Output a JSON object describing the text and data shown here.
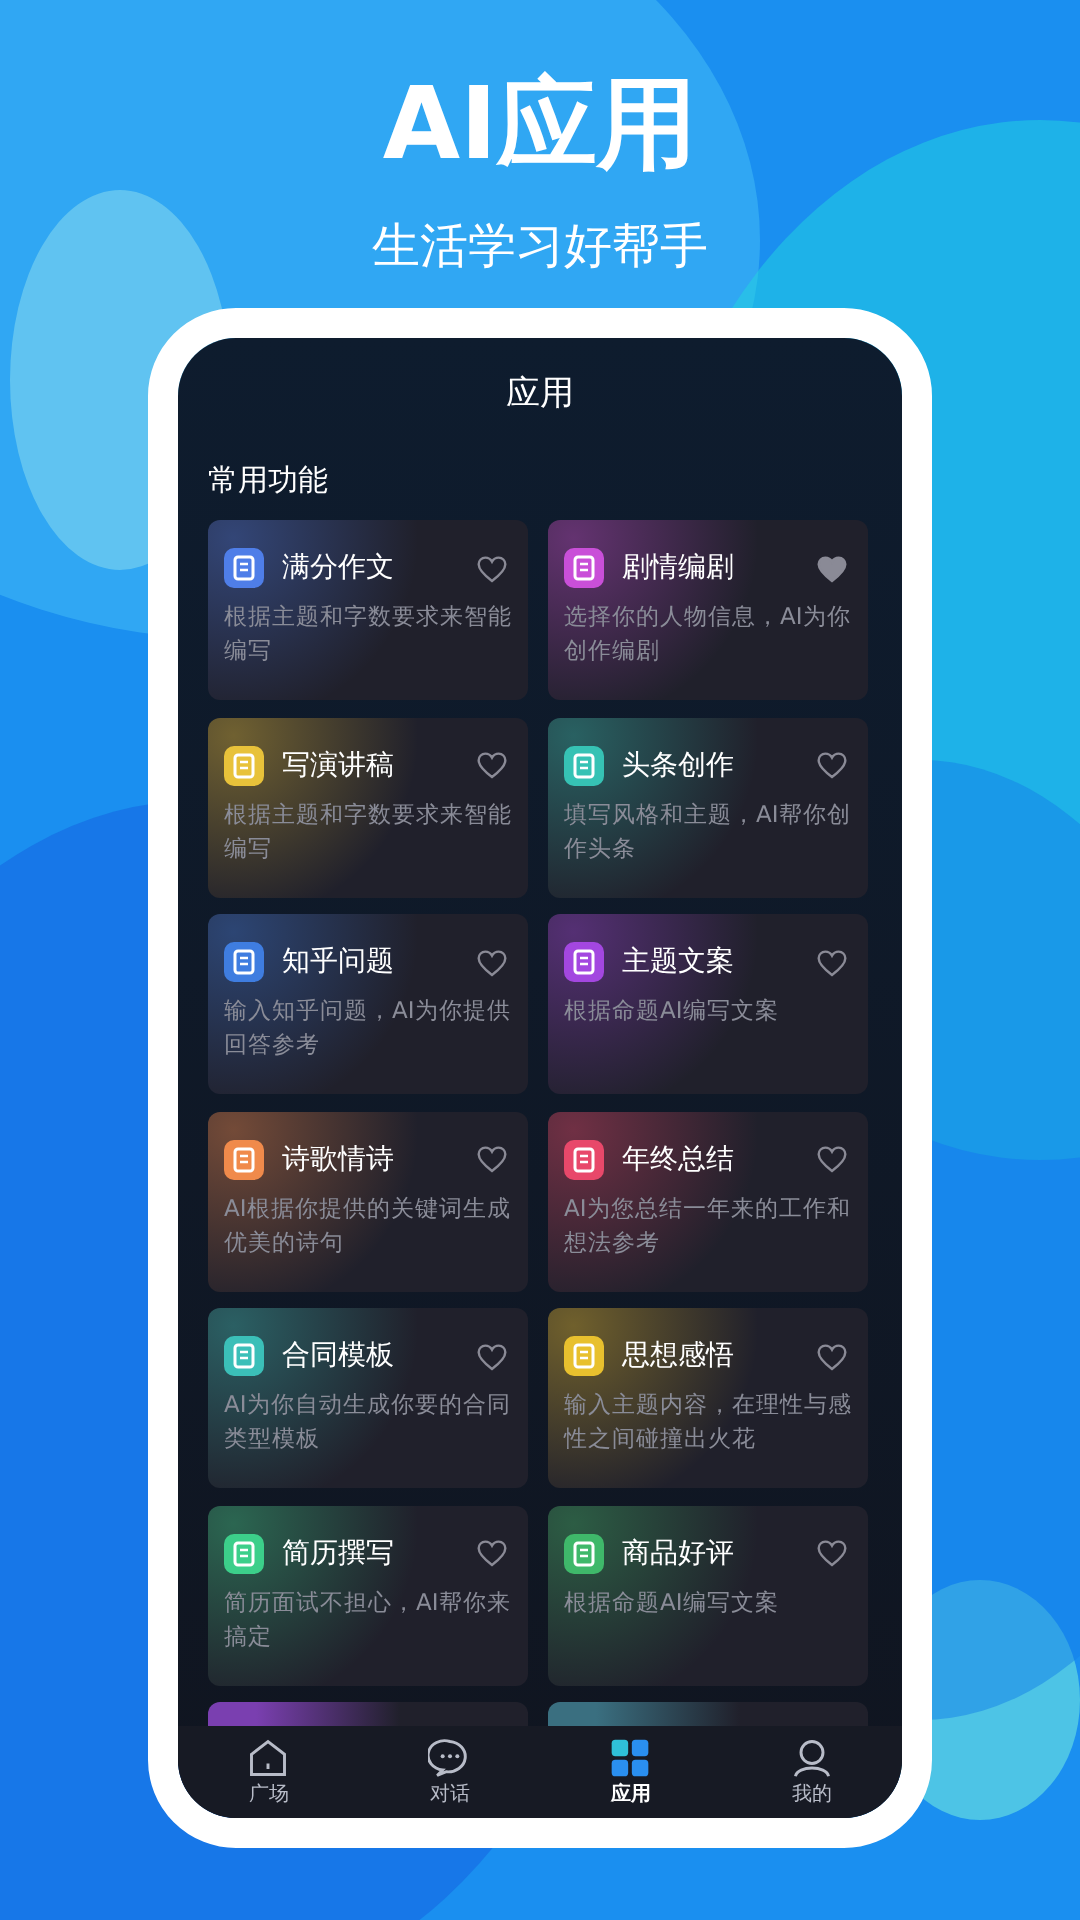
{
  "hero": {
    "title": "AI应用",
    "subtitle": "生活学习好帮手"
  },
  "screen": {
    "title": "应用",
    "section": "常用功能"
  },
  "apps": [
    {
      "title": "满分作文",
      "desc": "根据主题和字数要求来智能编写",
      "color": "#4f7ee8",
      "favorited": false
    },
    {
      "title": "剧情编剧",
      "desc": "选择你的人物信息，AI为你创作编剧",
      "color": "#c94fd8",
      "favorited": true
    },
    {
      "title": "写演讲稿",
      "desc": "根据主题和字数要求来智能编写",
      "color": "#e8c23a",
      "favorited": false
    },
    {
      "title": "头条创作",
      "desc": "填写风格和主题，AI帮你创作头条",
      "color": "#36c2b4",
      "favorited": false
    },
    {
      "title": "知乎问题",
      "desc": "输入知乎问题，AI为你提供回答参考",
      "color": "#3f7de0",
      "favorited": false
    },
    {
      "title": "主题文案",
      "desc": "根据命题AI编写文案",
      "color": "#a347e0",
      "favorited": false
    },
    {
      "title": "诗歌情诗",
      "desc": "AI根据你提供的关键词生成优美的诗句",
      "color": "#f08a4b",
      "favorited": false
    },
    {
      "title": "年终总结",
      "desc": "AI为您总结一年来的工作和想法参考",
      "color": "#e8486a",
      "favorited": false
    },
    {
      "title": "合同模板",
      "desc": "AI为你自动生成你要的合同类型模板",
      "color": "#3bbfb8",
      "favorited": false
    },
    {
      "title": "思想感悟",
      "desc": "输入主题内容，在理性与感性之间碰撞出火花",
      "color": "#e8c02e",
      "favorited": false
    },
    {
      "title": "简历撰写",
      "desc": "简历面试不担心，AI帮你来搞定",
      "color": "#3ccf8a",
      "favorited": false
    },
    {
      "title": "商品好评",
      "desc": "根据命题AI编写文案",
      "color": "#3fb86a",
      "favorited": false
    },
    {
      "color": "#7a3fb0"
    },
    {
      "color": "#3a6f80"
    }
  ],
  "tabs": [
    {
      "label": "广场",
      "kind": "home",
      "selected": false
    },
    {
      "label": "对话",
      "kind": "chat",
      "selected": false
    },
    {
      "label": "应用",
      "kind": "apps",
      "selected": true
    },
    {
      "label": "我的",
      "kind": "profile",
      "selected": false
    }
  ]
}
